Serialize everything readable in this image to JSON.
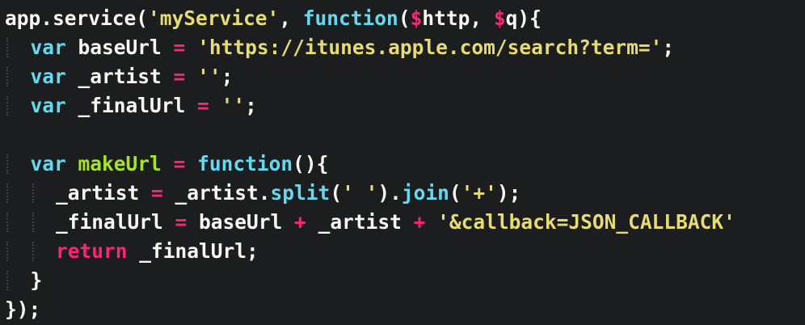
{
  "colors": {
    "background": "#1b1d1e",
    "plain": "#f8f8f2",
    "keyword": "#66d9ef",
    "string": "#e6db74",
    "operator": "#f92672",
    "function_name": "#a6e22e",
    "indent_guide": "#3e4144"
  },
  "lines": [
    {
      "indent": 0,
      "tokens": [
        {
          "t": "app.service(",
          "c": "plain"
        },
        {
          "t": "'myService'",
          "c": "string"
        },
        {
          "t": ", ",
          "c": "plain"
        },
        {
          "t": "function",
          "c": "keyword"
        },
        {
          "t": "(",
          "c": "plain"
        },
        {
          "t": "$",
          "c": "operator"
        },
        {
          "t": "http, ",
          "c": "plain"
        },
        {
          "t": "$",
          "c": "operator"
        },
        {
          "t": "q){",
          "c": "plain"
        }
      ]
    },
    {
      "indent": 1,
      "tokens": [
        {
          "t": "var",
          "c": "keyword"
        },
        {
          "t": " baseUrl ",
          "c": "plain"
        },
        {
          "t": "=",
          "c": "operator"
        },
        {
          "t": " ",
          "c": "plain"
        },
        {
          "t": "'https://itunes.apple.com/search?term='",
          "c": "string"
        },
        {
          "t": ";",
          "c": "plain"
        }
      ]
    },
    {
      "indent": 1,
      "tokens": [
        {
          "t": "var",
          "c": "keyword"
        },
        {
          "t": " _artist ",
          "c": "plain"
        },
        {
          "t": "=",
          "c": "operator"
        },
        {
          "t": " ",
          "c": "plain"
        },
        {
          "t": "''",
          "c": "string"
        },
        {
          "t": ";",
          "c": "plain"
        }
      ]
    },
    {
      "indent": 1,
      "tokens": [
        {
          "t": "var",
          "c": "keyword"
        },
        {
          "t": " _finalUrl ",
          "c": "plain"
        },
        {
          "t": "=",
          "c": "operator"
        },
        {
          "t": " ",
          "c": "plain"
        },
        {
          "t": "''",
          "c": "string"
        },
        {
          "t": ";",
          "c": "plain"
        }
      ]
    },
    {
      "indent": 0,
      "tokens": []
    },
    {
      "indent": 1,
      "tokens": [
        {
          "t": "var",
          "c": "keyword"
        },
        {
          "t": " ",
          "c": "plain"
        },
        {
          "t": "makeUrl",
          "c": "function_name"
        },
        {
          "t": " ",
          "c": "plain"
        },
        {
          "t": "=",
          "c": "operator"
        },
        {
          "t": " ",
          "c": "plain"
        },
        {
          "t": "function",
          "c": "keyword"
        },
        {
          "t": "(){",
          "c": "plain"
        }
      ]
    },
    {
      "indent": 2,
      "tokens": [
        {
          "t": "_artist ",
          "c": "plain"
        },
        {
          "t": "=",
          "c": "operator"
        },
        {
          "t": " _artist.",
          "c": "plain"
        },
        {
          "t": "split",
          "c": "keyword"
        },
        {
          "t": "(",
          "c": "plain"
        },
        {
          "t": "' '",
          "c": "string"
        },
        {
          "t": ").",
          "c": "plain"
        },
        {
          "t": "join",
          "c": "keyword"
        },
        {
          "t": "(",
          "c": "plain"
        },
        {
          "t": "'+'",
          "c": "string"
        },
        {
          "t": ");",
          "c": "plain"
        }
      ]
    },
    {
      "indent": 2,
      "tokens": [
        {
          "t": "_finalUrl ",
          "c": "plain"
        },
        {
          "t": "=",
          "c": "operator"
        },
        {
          "t": " baseUrl ",
          "c": "plain"
        },
        {
          "t": "+",
          "c": "operator"
        },
        {
          "t": " _artist ",
          "c": "plain"
        },
        {
          "t": "+",
          "c": "operator"
        },
        {
          "t": " ",
          "c": "plain"
        },
        {
          "t": "'&callback=JSON_CALLBACK'",
          "c": "string"
        }
      ]
    },
    {
      "indent": 2,
      "tokens": [
        {
          "t": "return",
          "c": "operator"
        },
        {
          "t": " _finalUrl;",
          "c": "plain"
        }
      ]
    },
    {
      "indent": 1,
      "tokens": [
        {
          "t": "}",
          "c": "plain"
        }
      ]
    },
    {
      "indent": 0,
      "tokens": [
        {
          "t": "});",
          "c": "plain"
        }
      ]
    }
  ]
}
